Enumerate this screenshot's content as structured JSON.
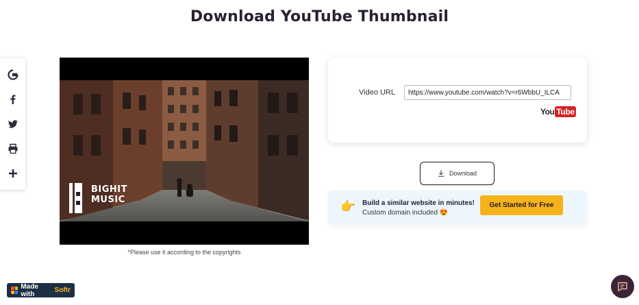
{
  "page": {
    "title": "Download YouTube Thumbnail"
  },
  "share": {
    "items": [
      {
        "icon": "google-icon"
      },
      {
        "icon": "facebook-icon"
      },
      {
        "icon": "twitter-icon"
      },
      {
        "icon": "print-icon"
      },
      {
        "icon": "plus-icon"
      }
    ]
  },
  "thumbnail": {
    "logo_line1": "BIGHIT",
    "logo_line2": "MUSIC",
    "copyright_note": "*Please use it according to the copyrights"
  },
  "form": {
    "video_url_label": "Video URL",
    "video_url_value": "https://www.youtube.com/watch?v=r6WbbU_ILCA",
    "yt_logo_you": "You",
    "yt_logo_tube": "Tube"
  },
  "download": {
    "label": "Download",
    "icon": "download-icon"
  },
  "promo": {
    "hand_icon": "👉",
    "title": "Build a similar website in minutes!",
    "subtitle": "Custom domain included 😍",
    "cta": "Get Started for Free"
  },
  "softr_badge": {
    "prefix": "Made with",
    "brand": "Softr"
  },
  "colors": {
    "title": "#2a1f33",
    "cta_bg": "#f6b21b",
    "promo_bg": "#eef6fd",
    "softr_bg": "#1d2f45",
    "chat_bg": "#3a2436",
    "youtube_red": "#d62222"
  }
}
